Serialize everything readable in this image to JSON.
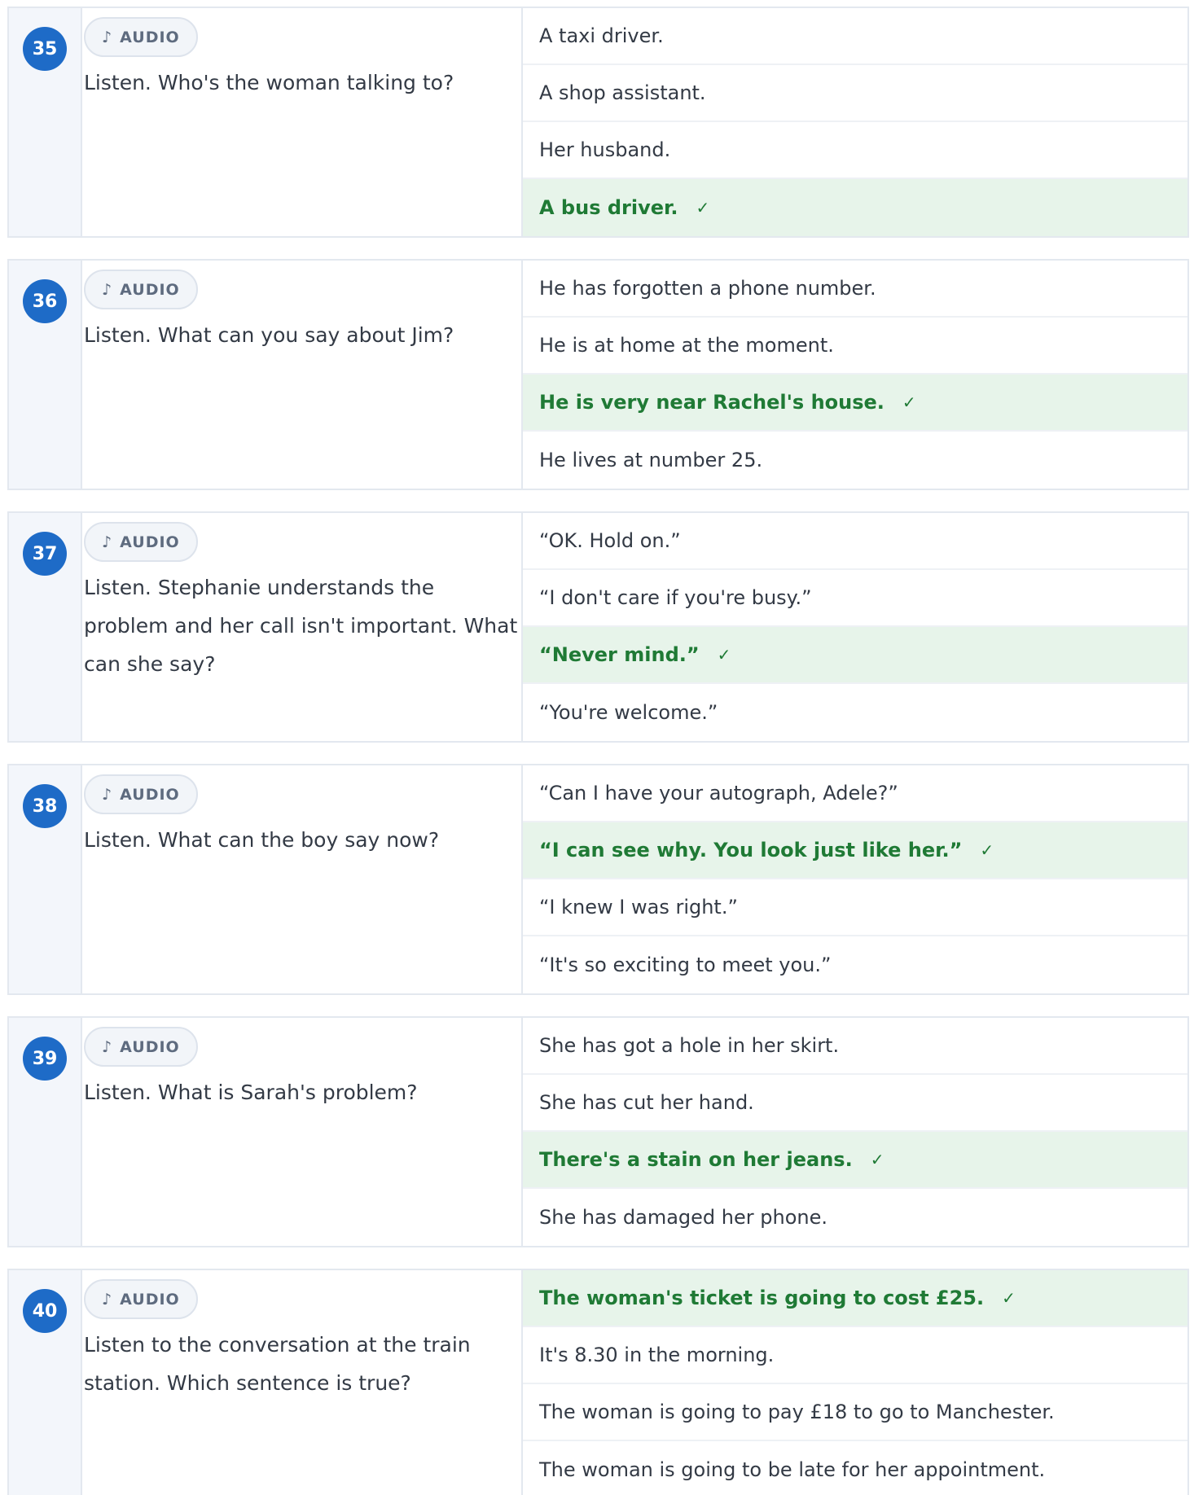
{
  "audio_label": "AUDIO",
  "questions": [
    {
      "number": "35",
      "prompt": "Listen. Who's the woman talking to?",
      "options": [
        {
          "text": "A taxi driver.",
          "correct": false
        },
        {
          "text": "A shop assistant.",
          "correct": false
        },
        {
          "text": "Her husband.",
          "correct": false
        },
        {
          "text": "A bus driver.",
          "correct": true
        }
      ]
    },
    {
      "number": "36",
      "prompt": "Listen. What can you say about Jim?",
      "options": [
        {
          "text": "He has forgotten a phone number.",
          "correct": false
        },
        {
          "text": "He is at home at the moment.",
          "correct": false
        },
        {
          "text": "He is very near Rachel's house.",
          "correct": true
        },
        {
          "text": "He lives at number 25.",
          "correct": false
        }
      ]
    },
    {
      "number": "37",
      "prompt": "Listen. Stephanie understands the problem and her call isn't important. What can she say?",
      "options": [
        {
          "text": "“OK. Hold on.”",
          "correct": false
        },
        {
          "text": "“I don't care if you're busy.”",
          "correct": false
        },
        {
          "text": "“Never mind.”",
          "correct": true
        },
        {
          "text": "“You're welcome.”",
          "correct": false
        }
      ]
    },
    {
      "number": "38",
      "prompt": "Listen. What can the boy say now?",
      "options": [
        {
          "text": "“Can I have your autograph, Adele?”",
          "correct": false
        },
        {
          "text": "“I can see why. You look just like her.”",
          "correct": true
        },
        {
          "text": "“I knew I was right.”",
          "correct": false
        },
        {
          "text": "“It's so exciting to meet you.”",
          "correct": false
        }
      ]
    },
    {
      "number": "39",
      "prompt": "Listen. What is Sarah's problem?",
      "options": [
        {
          "text": "She has got a hole in her skirt.",
          "correct": false
        },
        {
          "text": "She has cut her hand.",
          "correct": false
        },
        {
          "text": "There's a stain on her jeans.",
          "correct": true
        },
        {
          "text": "She has damaged her phone.",
          "correct": false
        }
      ]
    },
    {
      "number": "40",
      "prompt": "Listen to the conversation at the train station. Which sentence is true?",
      "options": [
        {
          "text": "The woman's ticket is going to cost £25.",
          "correct": true
        },
        {
          "text": "It's 8.30 in the morning.",
          "correct": false
        },
        {
          "text": "The woman is going to pay £18 to go to Manchester.",
          "correct": false
        },
        {
          "text": "The woman is going to be late for her appointment.",
          "correct": false
        }
      ]
    }
  ]
}
